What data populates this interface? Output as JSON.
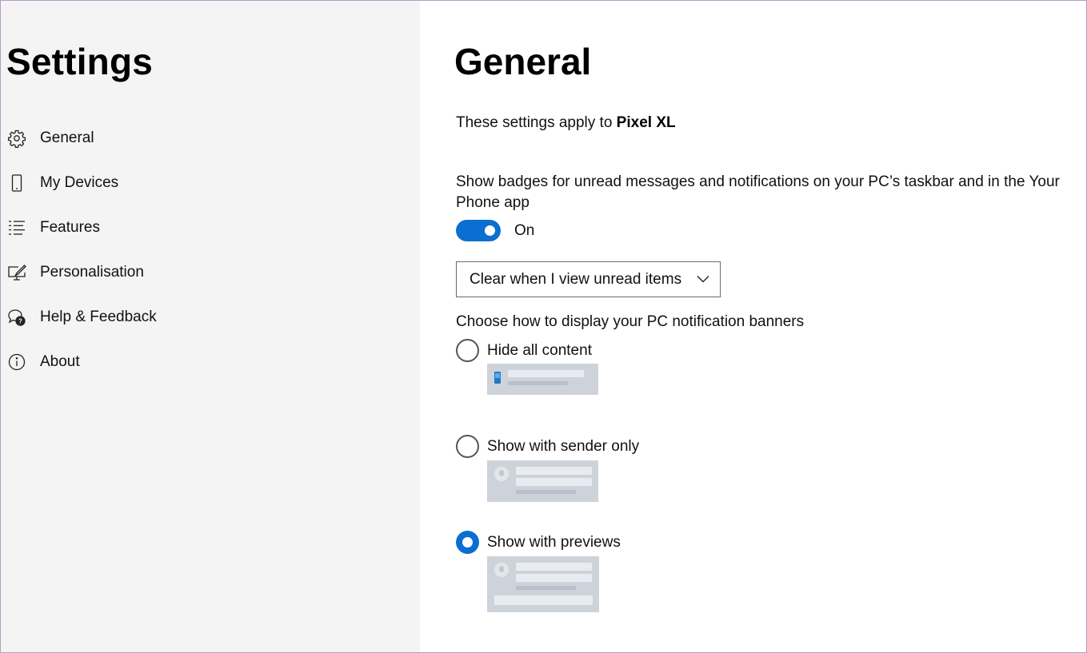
{
  "sidebar": {
    "title": "Settings",
    "items": [
      {
        "label": "General",
        "icon": "gear-icon"
      },
      {
        "label": "My Devices",
        "icon": "phone-icon"
      },
      {
        "label": "Features",
        "icon": "list-icon"
      },
      {
        "label": "Personalisation",
        "icon": "paint-monitor-icon"
      },
      {
        "label": "Help & Feedback",
        "icon": "help-chat-icon"
      },
      {
        "label": "About",
        "icon": "info-icon"
      }
    ]
  },
  "main": {
    "title": "General",
    "applies_prefix": "These settings apply to ",
    "device_name": "Pixel XL",
    "badge_setting_label": "Show badges for unread messages and notifications on your PC’s taskbar and in the Your Phone app",
    "badge_toggle": {
      "state": "On",
      "enabled": true
    },
    "clear_dropdown": {
      "selected": "Clear when I view unread items"
    },
    "banner_setting_label": "Choose how to display your PC notification banners",
    "banner_options": [
      {
        "label": "Hide all content",
        "selected": false
      },
      {
        "label": "Show with sender only",
        "selected": false
      },
      {
        "label": "Show with previews",
        "selected": true
      }
    ]
  },
  "colors": {
    "accent": "#0a6fd0",
    "sidebar_bg": "#f4f4f4",
    "preview_bg": "#ced3db"
  }
}
